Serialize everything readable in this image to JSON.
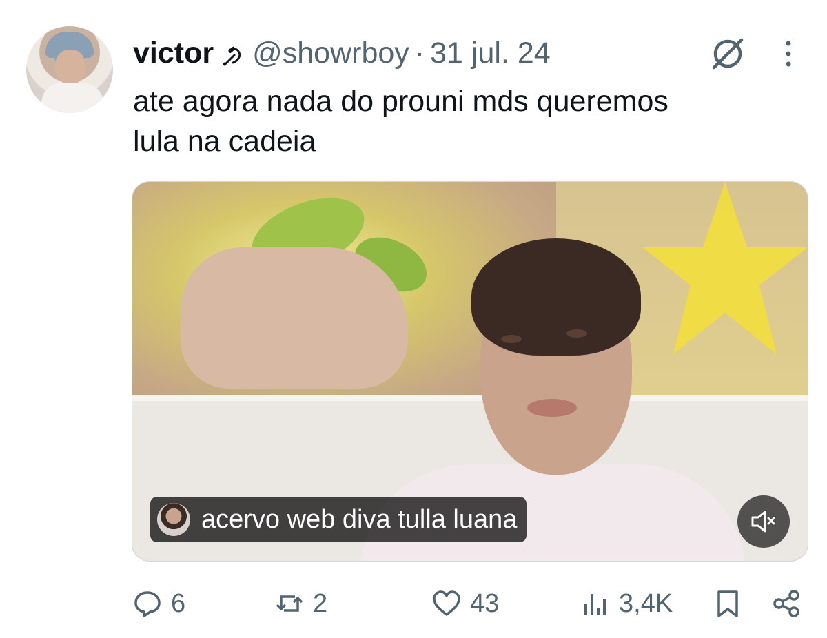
{
  "tweet": {
    "author_name": "victor",
    "author_badge": "hammer-and-sickle-emoji",
    "handle": "@showrboy",
    "separator": "·",
    "date": "31 jul. 24",
    "text": "ate agora nada do prouni mds queremos\nlula na cadeia"
  },
  "media": {
    "caption": "acervo web diva tulla luana",
    "muted": true
  },
  "actions": {
    "replies": "6",
    "reposts": "2",
    "likes": "43",
    "views": "3,4K"
  },
  "colors": {
    "text_primary": "#0f1419",
    "text_secondary": "#536471",
    "border": "#cfd9de"
  }
}
